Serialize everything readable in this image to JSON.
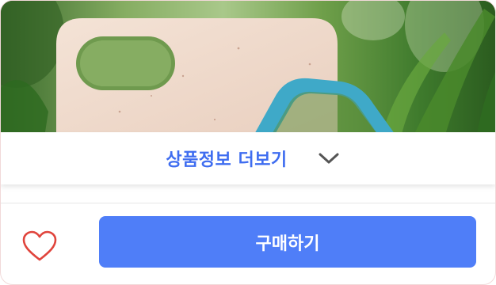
{
  "product_image": {
    "description_icon": "phone-case-image"
  },
  "more_info": {
    "label": "상품정보 더보기",
    "icon": "chevron-down-icon",
    "color": "#3f6df0"
  },
  "actions": {
    "wishlist_icon": "heart-icon",
    "wishlist_color": "#e0443c",
    "buy_label": "구매하기",
    "buy_color": "#4f7ef8"
  }
}
